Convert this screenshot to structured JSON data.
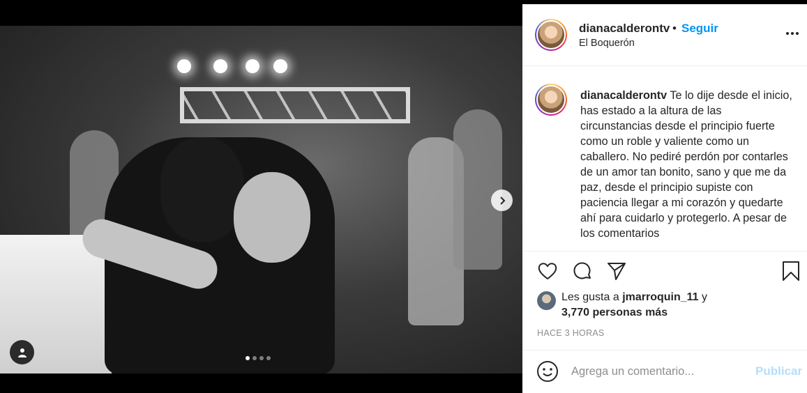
{
  "post": {
    "username": "dianacalderontv",
    "follow_label": "Seguir",
    "separator": "•",
    "location": "El Boquerón",
    "caption_user": "dianacalderontv",
    "caption_text": "Te lo dije desde el inicio, has estado a la altura de las circunstancias desde el principio fuerte como un roble y valiente como un caballero. No pediré perdón por contarles de un amor tan bonito, sano y que me da paz, desde el principio supiste con paciencia llegar a mi corazón y quedarte ahí para cuidarlo y protegerlo. A pesar de los comentarios",
    "likes_prefix": "Les gusta a",
    "likes_user": "jmarroquin_11",
    "likes_conj": "y",
    "likes_count": "3,770 personas más",
    "time_ago": "HACE 3 HORAS",
    "comment_placeholder": "Agrega un comentario...",
    "publish_label": "Publicar",
    "carousel": {
      "total_slides": 4,
      "active_slide": 1
    }
  },
  "icons": {
    "like": "heart-icon",
    "comment": "comment-icon",
    "share": "paper-plane-icon",
    "save": "bookmark-icon",
    "more": "more-icon",
    "emoji": "emoji-icon",
    "next": "chevron-right-icon",
    "user_tag": "user-tag-icon"
  },
  "colors": {
    "link_blue": "#0095f6",
    "publish_disabled": "#b2dffc",
    "muted": "#8e8e8e"
  }
}
